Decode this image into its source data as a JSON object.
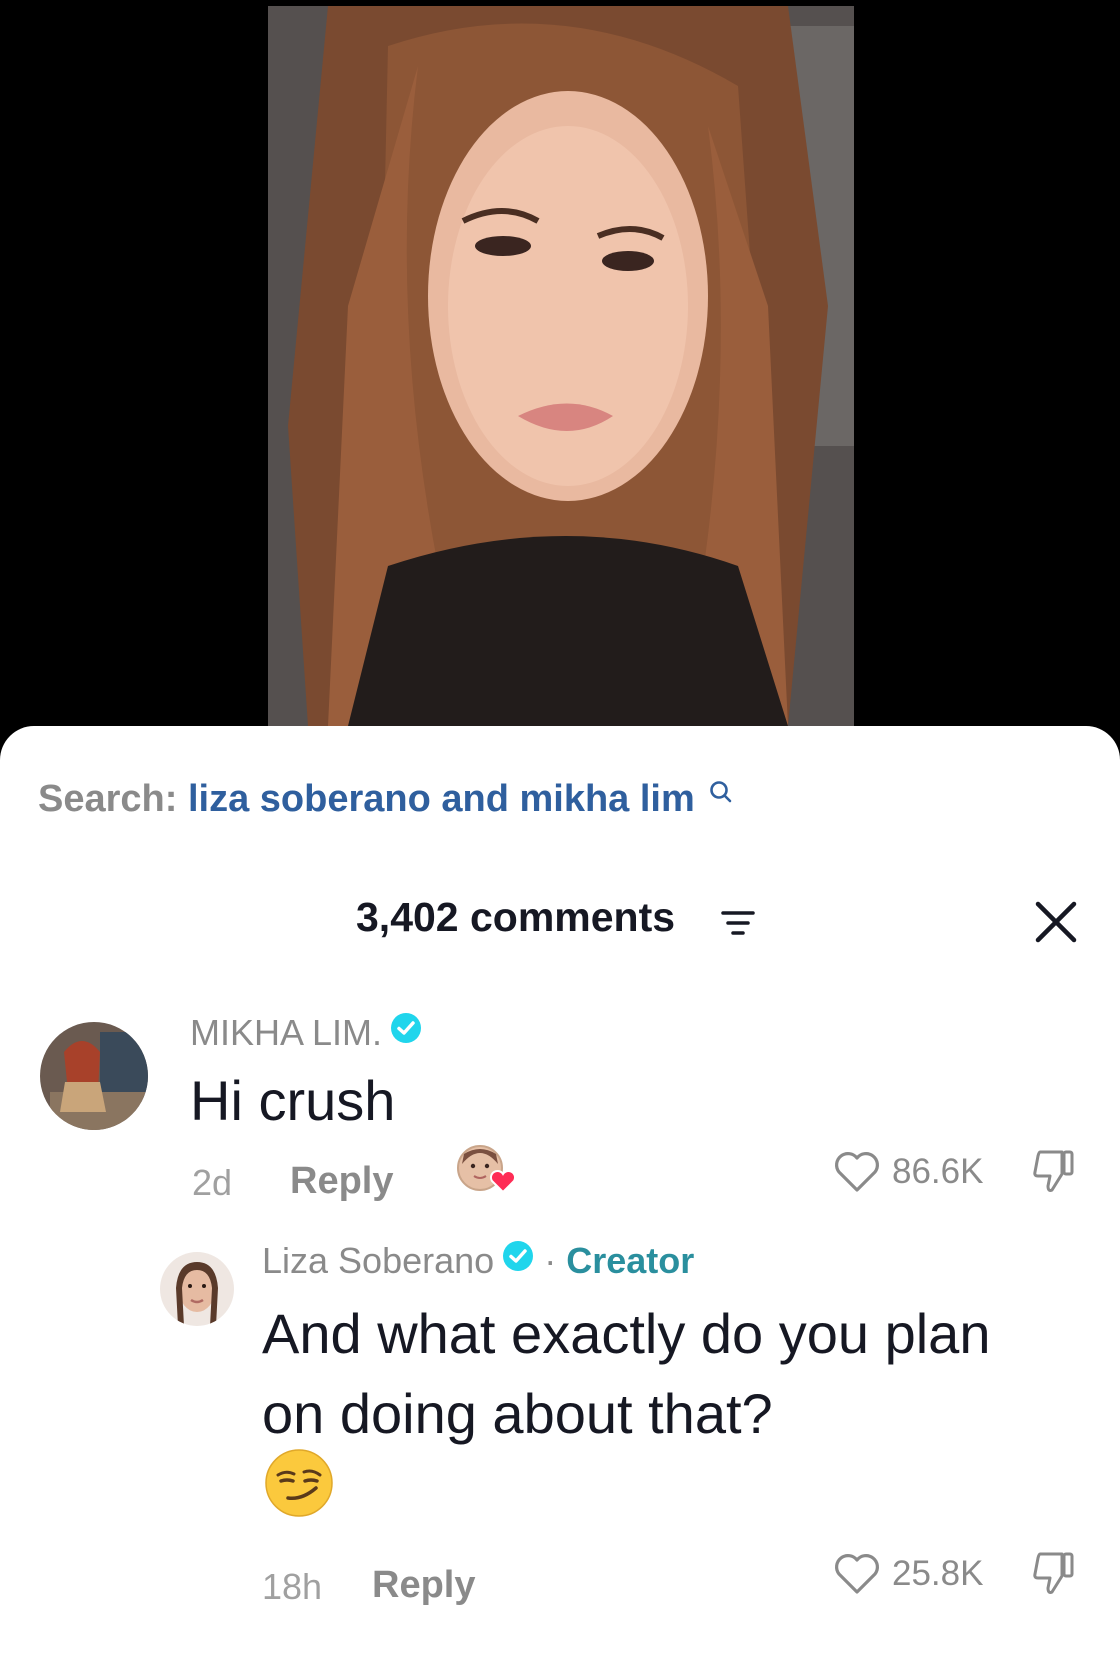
{
  "search": {
    "prefix": "Search:",
    "query": "liza soberano and mikha lim"
  },
  "comments_header": {
    "count_label": "3,402 comments"
  },
  "comments": [
    {
      "username": "MIKHA LIM.",
      "verified": true,
      "text": "Hi crush",
      "age": "2d",
      "reply_label": "Reply",
      "likes": "86.6K",
      "liked_by_creator": true
    },
    {
      "username": "Liza Soberano",
      "verified": true,
      "badge_separator": "·",
      "badge": "Creator",
      "text": "And what exactly do you plan on doing about that?",
      "emoji": "smirking-face",
      "age": "18h",
      "reply_label": "Reply",
      "likes": "25.8K"
    }
  ],
  "colors": {
    "search_query": "#2f5f9e",
    "verified": "#20d5ec",
    "creator": "#2a8f9e",
    "text_primary": "#161823",
    "text_secondary": "#8a8a8a"
  }
}
